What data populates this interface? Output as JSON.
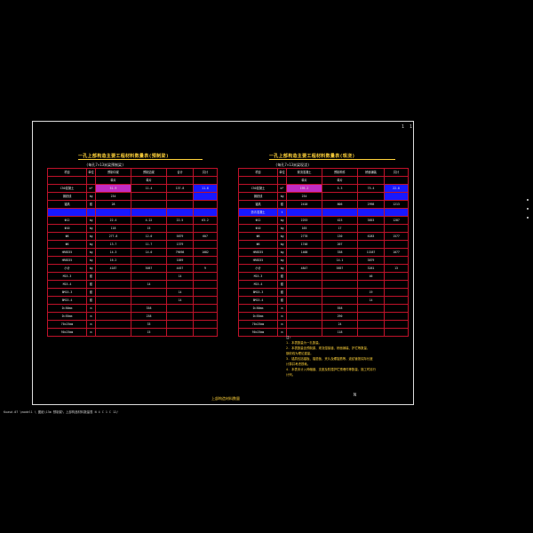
{
  "page_marks": [
    "1",
    "1"
  ],
  "left": {
    "title": "一孔上部构造主要工程材料数量表(预制梁)",
    "caption": "(每孔7×13米梁预制梁)",
    "header": [
      "项目",
      "单位",
      "预制中梁",
      "预制边梁",
      "合计",
      "共计"
    ],
    "subheader": [
      "",
      "",
      "单片",
      "单片",
      "",
      ""
    ],
    "rows": [
      [
        "C50混凝土",
        "m³",
        "51.9",
        "11.4",
        "137.8",
        "11.6"
      ],
      [
        "钢绞线",
        "kg",
        "234",
        "",
        "",
        ""
      ],
      [
        "锚具",
        "套",
        "28",
        "",
        "",
        ""
      ],
      [
        "",
        "",
        "",
        "",
        "",
        ""
      ],
      [
        "Φ12",
        "kg",
        "22.4",
        "4.22",
        "22.5",
        "63.2"
      ],
      [
        "Φ10",
        "kg",
        "118",
        "15",
        "",
        ""
      ],
      [
        "Φ8",
        "kg",
        "277.8",
        "12.0",
        "5879",
        "607"
      ],
      [
        "Φ6",
        "kg",
        "13.7",
        "11.7",
        "1379",
        ""
      ],
      [
        "HRB335",
        "kg",
        "14.3",
        "14.0",
        "79098",
        "1082"
      ],
      [
        "HRB335",
        "kg",
        "16.2",
        "",
        "1059",
        ""
      ],
      [
        "小计",
        "kg",
        "4187",
        "5057",
        "4457",
        "9"
      ],
      [
        "M15-3",
        "套",
        "",
        "",
        "14",
        ""
      ],
      [
        "M15-4",
        "套",
        "",
        "14",
        "",
        ""
      ],
      [
        "BM15-3",
        "套",
        "",
        "",
        "14",
        ""
      ],
      [
        "BM15-4",
        "套",
        "",
        "",
        "14",
        ""
      ],
      [
        "D=50mm",
        "m",
        "",
        "338",
        "",
        ""
      ],
      [
        "D=55mm",
        "m",
        "",
        "238",
        "",
        ""
      ],
      [
        "70×25mm",
        "m",
        "",
        "33",
        "",
        ""
      ],
      [
        "90×25mm",
        "m",
        "",
        "15",
        "",
        ""
      ]
    ],
    "group_labels": [
      "普通钢筋",
      "锚具",
      "波纹管"
    ]
  },
  "right": {
    "title": "一孔上部构造主要工程材料数量表(现浇)",
    "caption": "(每孔7×13米梁现浇)",
    "header": [
      "项目",
      "单位",
      "现浇混凝土",
      "预制构件",
      "桥面铺装",
      "共计"
    ],
    "subheader": [
      "",
      "",
      "单片",
      "单片",
      "",
      ""
    ],
    "rows": [
      [
        "C50混凝土",
        "m³",
        "195.2",
        "5.3",
        "75.4",
        "22.0"
      ],
      [
        "钢绞线",
        "kg",
        "234",
        "",
        "",
        ""
      ],
      [
        "锚具",
        "套",
        "2418",
        "806",
        "2998",
        "1213"
      ],
      [
        "沥青混凝土",
        "t",
        "",
        "",
        "",
        ""
      ],
      [
        "Φ12",
        "kg",
        "2253",
        "423",
        "3853",
        "1287"
      ],
      [
        "Φ10",
        "kg",
        "165",
        "17",
        "",
        ""
      ],
      [
        "Φ8",
        "kg",
        "2778",
        "130",
        "6283",
        "1577"
      ],
      [
        "Φ6",
        "kg",
        "1748",
        "207",
        "",
        ""
      ],
      [
        "HRB335",
        "kg",
        "1468",
        "338",
        "11587",
        "1077"
      ],
      [
        "HRB335",
        "kg",
        "",
        "14.1",
        "3879",
        ""
      ],
      [
        "小计",
        "kg",
        "4847",
        "5857",
        "3261",
        "13"
      ],
      [
        "M15-3",
        "套",
        "",
        "",
        "46",
        ""
      ],
      [
        "M15-4",
        "套",
        "",
        "",
        "",
        ""
      ],
      [
        "BM15-3",
        "套",
        "",
        "",
        "19",
        ""
      ],
      [
        "BM15-4",
        "套",
        "",
        "",
        "14",
        ""
      ],
      [
        "D=50mm",
        "m",
        "",
        "558",
        "",
        ""
      ],
      [
        "D=55mm",
        "m",
        "",
        "290",
        "",
        ""
      ],
      [
        "70×25mm",
        "m",
        "",
        "24",
        "",
        ""
      ],
      [
        "90×25mm",
        "m",
        "",
        "118",
        "",
        ""
      ]
    ],
    "group_labels": [
      "普通钢筋",
      "锚具",
      "波纹管"
    ]
  },
  "notes": {
    "heading": "注:",
    "items": [
      "1. 本表数量为一孔数量。",
      "2. 本表数量含预制梁、现浇湿接缝、桥面铺装、护栏等数量，",
      "   钢绞线为理论重量。",
      "3. 锚具包括锚板、锚垫板、夹片及螺旋筋等，波纹管按实际长度",
      "   计算并考虑损耗。",
      "4. 本表未计入伸缩缝、支座及防撞护栏预埋件等数量，施工时另行",
      "   计列。"
    ]
  },
  "sheet_title": "上部构造材料数量",
  "sheet_number": "N",
  "footer_path": "Kuasd.07 \\model1 \\ 图纸\\13m 预制梁\\ 上部构造材料数量表 N 4 C 1 C 12/"
}
